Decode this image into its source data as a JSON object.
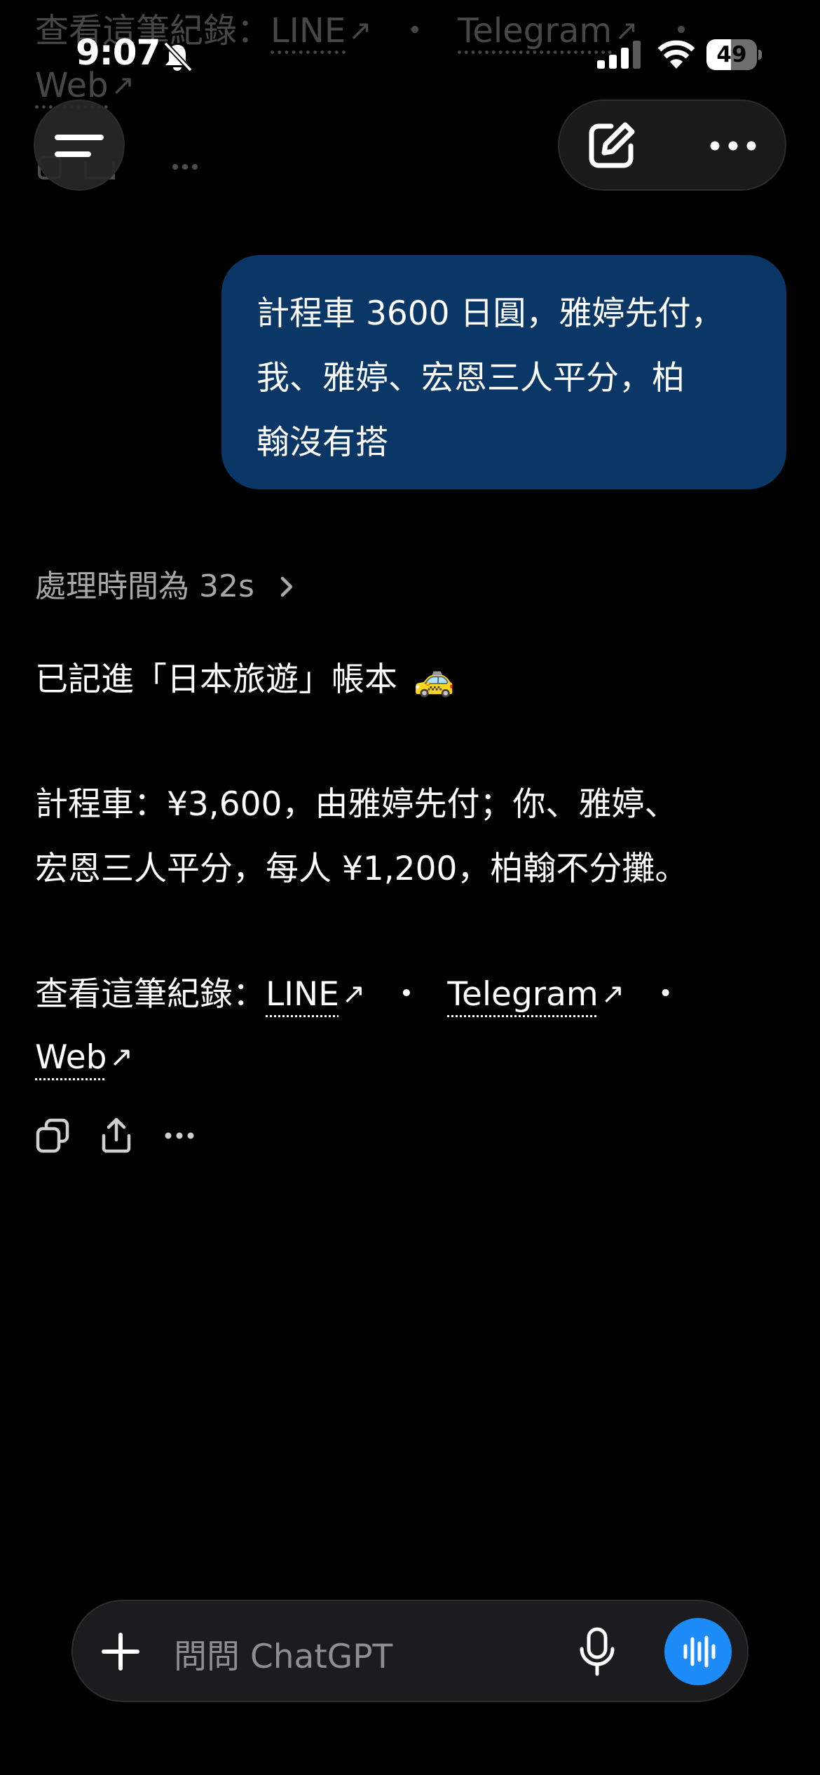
{
  "status_bar": {
    "time": "9:07",
    "battery": 49
  },
  "ghost_footer": {
    "prefix": "查看這筆紀錄：",
    "line": "LINE",
    "sep": "・",
    "telegram": "Telegram",
    "web": "Web"
  },
  "user_message": {
    "lines": [
      "計程車 3600 日圓，雅婷先付，",
      "我、雅婷、宏恩三人平分，柏",
      "翰沒有搭"
    ]
  },
  "assistant": {
    "thinking": "處理時間為 32s",
    "line1": "已記進「日本旅遊」帳本",
    "line1_emoji": "🚕",
    "para2": [
      "計程車：¥3,600，由雅婷先付；你、雅婷、",
      "宏恩三人平分，每人 ¥1,200，柏翰不分攤。"
    ],
    "footer_prefix": "查看這筆紀錄：",
    "links": {
      "line": "LINE",
      "telegram": "Telegram",
      "web": "Web"
    },
    "separator": "・"
  },
  "composer": {
    "placeholder": "問問 ChatGPT"
  },
  "colors": {
    "accent": "#1d8cf8",
    "bubble": "#0b3766"
  }
}
